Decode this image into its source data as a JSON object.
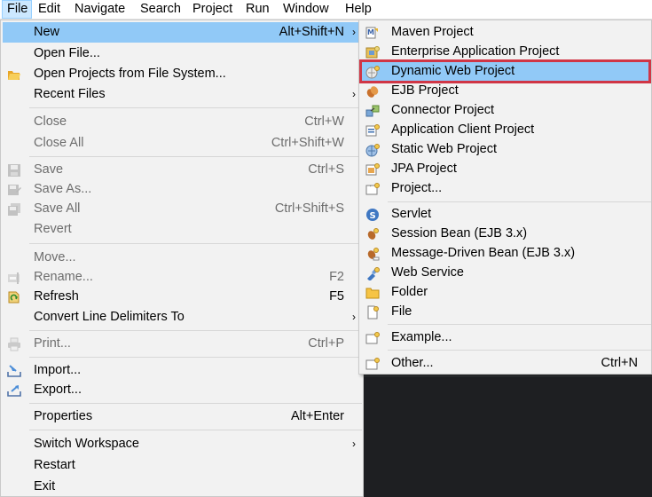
{
  "menubar": {
    "items": [
      "File",
      "Edit",
      "Navigate",
      "Search",
      "Project",
      "Run",
      "Window",
      "Help"
    ]
  },
  "file_menu": {
    "new": {
      "label": "New",
      "shortcut": "Alt+Shift+N"
    },
    "open_file": {
      "label": "Open File..."
    },
    "open_projects": {
      "label": "Open Projects from File System..."
    },
    "recent_files": {
      "label": "Recent Files"
    },
    "close": {
      "label": "Close",
      "shortcut": "Ctrl+W"
    },
    "close_all": {
      "label": "Close All",
      "shortcut": "Ctrl+Shift+W"
    },
    "save": {
      "label": "Save",
      "shortcut": "Ctrl+S"
    },
    "save_as": {
      "label": "Save As..."
    },
    "save_all": {
      "label": "Save All",
      "shortcut": "Ctrl+Shift+S"
    },
    "revert": {
      "label": "Revert"
    },
    "move": {
      "label": "Move..."
    },
    "rename": {
      "label": "Rename...",
      "shortcut": "F2"
    },
    "refresh": {
      "label": "Refresh",
      "shortcut": "F5"
    },
    "convert": {
      "label": "Convert Line Delimiters To"
    },
    "print": {
      "label": "Print...",
      "shortcut": "Ctrl+P"
    },
    "import": {
      "label": "Import..."
    },
    "export": {
      "label": "Export..."
    },
    "properties": {
      "label": "Properties",
      "shortcut": "Alt+Enter"
    },
    "switch_workspace": {
      "label": "Switch Workspace"
    },
    "restart": {
      "label": "Restart"
    },
    "exit": {
      "label": "Exit"
    }
  },
  "new_menu": {
    "maven": {
      "label": "Maven Project"
    },
    "enterprise": {
      "label": "Enterprise Application Project"
    },
    "dynamic_web": {
      "label": "Dynamic Web Project"
    },
    "ejb": {
      "label": "EJB Project"
    },
    "connector": {
      "label": "Connector Project"
    },
    "app_client": {
      "label": "Application Client Project"
    },
    "static_web": {
      "label": "Static Web Project"
    },
    "jpa": {
      "label": "JPA Project"
    },
    "project": {
      "label": "Project..."
    },
    "servlet": {
      "label": "Servlet"
    },
    "session_bean": {
      "label": "Session Bean (EJB 3.x)"
    },
    "mdb": {
      "label": "Message-Driven Bean (EJB 3.x)"
    },
    "web_service": {
      "label": "Web Service"
    },
    "folder": {
      "label": "Folder"
    },
    "file": {
      "label": "File"
    },
    "example": {
      "label": "Example..."
    },
    "other": {
      "label": "Other...",
      "shortcut": "Ctrl+N"
    }
  },
  "submenu_arrow": "›"
}
